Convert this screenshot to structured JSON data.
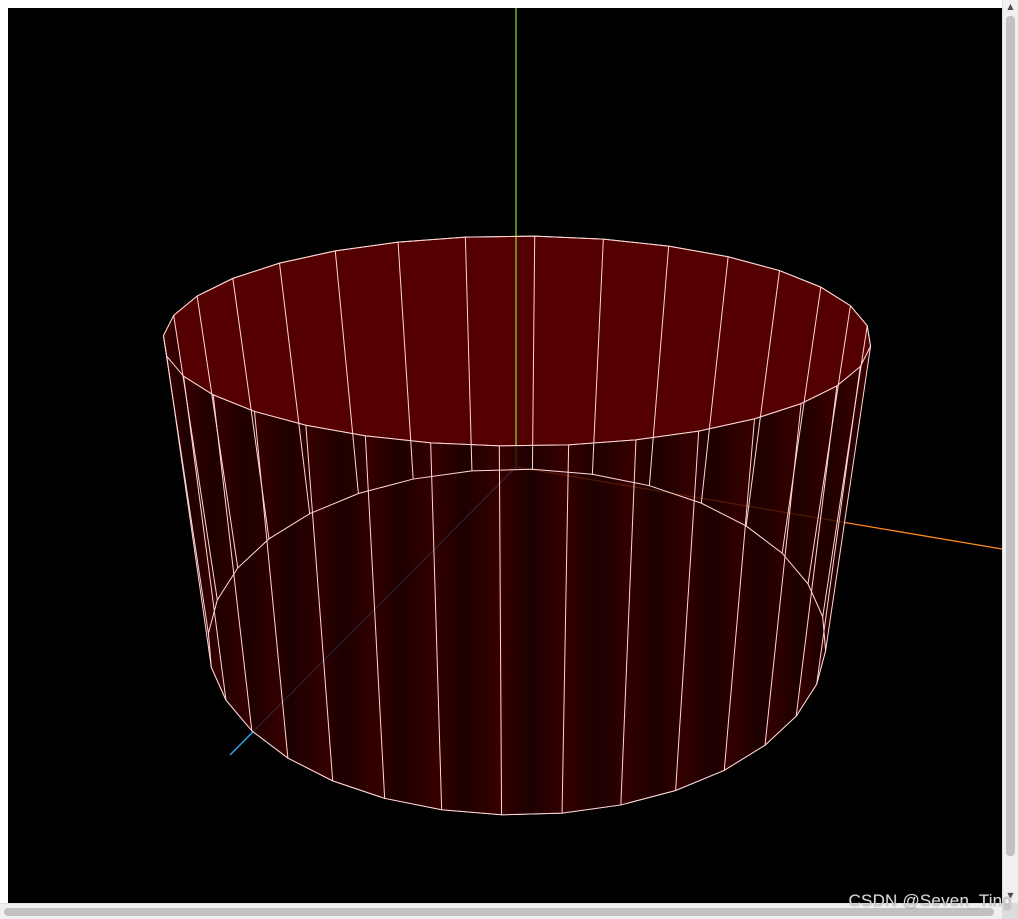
{
  "viewport": {
    "background_color": "#000000",
    "cylinder": {
      "segments": 32,
      "face_color": "#550000",
      "edge_color": "#ffd6d6"
    },
    "axes": [
      {
        "name": "y-axis",
        "color": "#7fd12a"
      },
      {
        "name": "x-axis",
        "color": "#ff8a1a"
      },
      {
        "name": "z-axis",
        "color": "#2fb0ff"
      }
    ]
  },
  "watermark": {
    "text": "CSDN @Seven_Ting"
  },
  "scrollbars": {
    "vertical_up_arrow": "▲",
    "vertical_down_arrow": "▼"
  }
}
